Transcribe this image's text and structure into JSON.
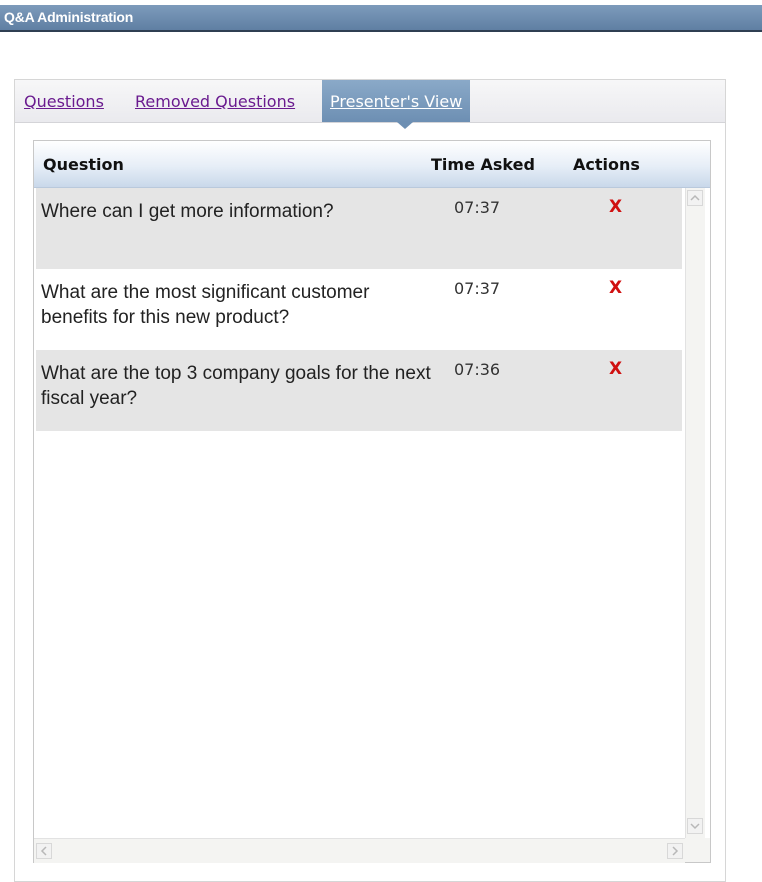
{
  "app": {
    "title": "Q&A Administration"
  },
  "tabs": [
    {
      "label": "Questions",
      "active": false
    },
    {
      "label": "Removed Questions",
      "active": false
    },
    {
      "label": "Presenter's View",
      "active": true
    }
  ],
  "table": {
    "columns": [
      "Question",
      "Time Asked",
      "Actions"
    ],
    "rows": [
      {
        "question": "Where can I get more information?",
        "time": "07:37",
        "action": "X"
      },
      {
        "question": "What are the most significant customer benefits for this new product?",
        "time": "07:37",
        "action": "X"
      },
      {
        "question": "What are the top 3 company goals for the next fiscal year?",
        "time": "07:36",
        "action": "X"
      }
    ]
  },
  "colors": {
    "titlebar": "#6d8cb0",
    "active_tab": "#7b9bbd",
    "link": "#6a1b8f",
    "delete": "#d01010",
    "row_shade": "#e5e5e5"
  },
  "icons": {
    "delete": "x-icon",
    "scroll_up": "scroll-up-arrow-icon",
    "scroll_down": "scroll-down-arrow-icon",
    "scroll_left": "scroll-left-arrow-icon",
    "scroll_right": "scroll-right-arrow-icon"
  }
}
